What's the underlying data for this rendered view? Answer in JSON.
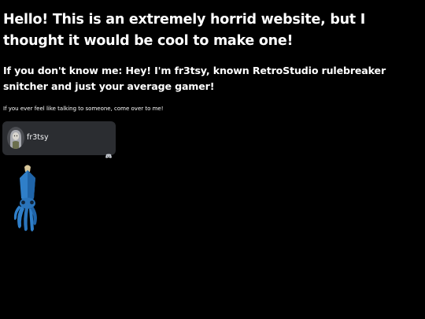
{
  "page": {
    "heading": "Hello! This is an extremely horrid website, but I thought it would be cool to make one!",
    "intro": "If you don't know me: Hey! I'm fr3tsy, known RetroStudio rulebreaker snitcher and just your average gamer!",
    "note": "If you ever feel like talking to someone, come over to me!"
  },
  "profile_card": {
    "username": "fr3tsy",
    "avatar_icon": "user-avatar",
    "platform_icon": "discord-icon"
  },
  "mascot": {
    "icon": "blue-squid-figure"
  },
  "colors": {
    "background": "#000000",
    "text": "#ffffff",
    "card": "#2b2d31",
    "squid": "#2f7fc9"
  }
}
